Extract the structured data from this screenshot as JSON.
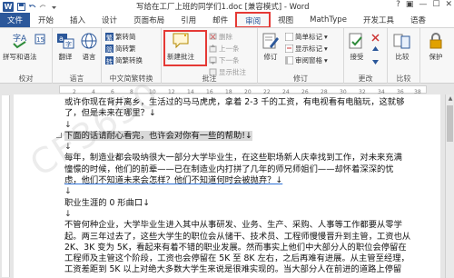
{
  "titlebar": {
    "app_icon": "W",
    "title": "写给在工厂上班的同学们1.doc [兼容模式] - Word",
    "controls": [
      "?",
      "▣",
      "—",
      "☐",
      "✕"
    ]
  },
  "tabs": [
    {
      "label": "文件"
    },
    {
      "label": "开始"
    },
    {
      "label": "插入"
    },
    {
      "label": "设计"
    },
    {
      "label": "页面布局"
    },
    {
      "label": "引用"
    },
    {
      "label": "邮件"
    },
    {
      "label": "审阅"
    },
    {
      "label": "视图"
    },
    {
      "label": "MathType"
    },
    {
      "label": "开发工具"
    },
    {
      "label": "语香"
    }
  ],
  "ribbon": {
    "proofing": {
      "label": "校对",
      "spell": "拼写和语法",
      "word_count": "字数"
    },
    "language": {
      "label": "语言",
      "translate": "翻译",
      "language": "语言"
    },
    "chinese": {
      "label": "中文简繁转换",
      "to_trad": "繁转简",
      "to_simp": "简转繁",
      "convert": "简繁转换"
    },
    "comments": {
      "label": "批注",
      "new_comment": "新建批注",
      "delete": "删除",
      "prev": "上一条",
      "next": "下一条",
      "show": "显示批注"
    },
    "tracking": {
      "label": "修订",
      "track": "修订",
      "display": "简单标记",
      "show_markup": "显示标记",
      "pane": "审阅窗格"
    },
    "changes": {
      "label": "更改",
      "accept": "接受"
    },
    "compare": {
      "label": "比较",
      "compare": "比较"
    },
    "protect": {
      "label": "",
      "protect": "保护"
    }
  },
  "ruler": {
    "ticks": [
      "2",
      "4",
      "6",
      "8",
      "10",
      "12",
      "14",
      "16",
      "18",
      "20",
      "22",
      "24",
      "26",
      "28",
      "30",
      "32",
      "34",
      "36",
      "38"
    ]
  },
  "document": {
    "lines": [
      "或许你现在背井离乡，生活过的马马虎虎，拿着 2-3 千的工资，有电视看有电脑玩，这就够",
      "了，但是未来在哪里？↓",
      "↓",
      "下面的话请耐心看完，也许会对你有一些的帮助!↓",
      "↓",
      "每年，制造业都会吸纳很大一部分大学毕业生，在这些职场新人庆幸找到工作，对未来充满",
      "憧憬的时候，他们的前辈——已在制造业内打拼了几年的师兄师姐们——却怀着深深的忧",
      "虑，他们不知道未来会怎样？他们不知道何时会被抛弃？↓",
      "↓",
      "职业生涯的 0 形曲口↓",
      "↓",
      "不管何种企业，大学毕业生进入其中从事研发、业务、生产、采购、人事等工作都要从零学",
      "起。两三年过去了，这些大学生的职位会从储干、技术员、工程师慢慢晋升到主管，工资也从",
      "2K、3K 变为 5K，看起来有着不错的职业发展。然而事实上他们中大部分人的职位会停留在",
      "工程师及主管这个阶段，工资也会停留在 5K 至 8K 左右，之后再难有进展。从主管至经理，",
      "工资差距到 5K 以上对绝大多数大学生来说是很难实现的。当大部分人在前进的道路上停留"
    ]
  },
  "watermark": "CE3650"
}
